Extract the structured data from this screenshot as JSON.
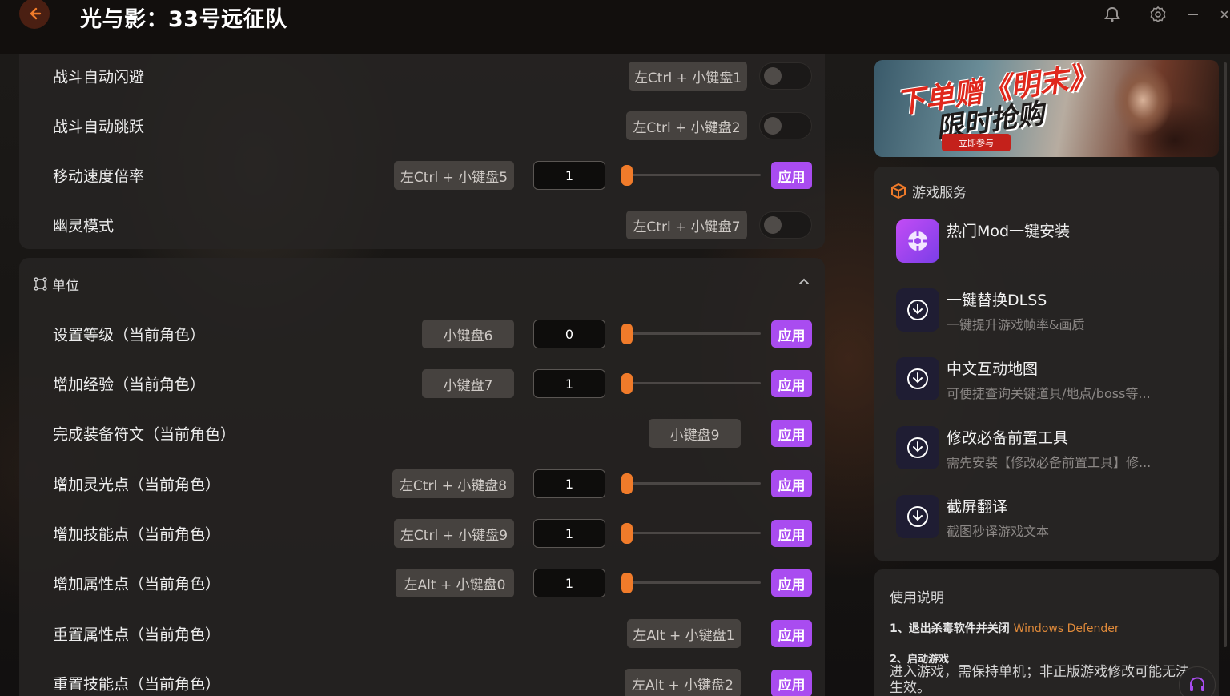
{
  "app": {
    "title": "光与影：33号远征队"
  },
  "colors": {
    "accent": "#f07b2a",
    "apply": "#a94cf0",
    "highlight": "#e08a3a"
  },
  "top_rows": [
    {
      "label": "战斗自动闪避",
      "hotkey": "左Ctrl + 小键盘1",
      "control": "toggle",
      "enabled": false
    },
    {
      "label": "战斗自动跳跃",
      "hotkey": "左Ctrl + 小键盘2",
      "control": "toggle",
      "enabled": false
    },
    {
      "label": "移动速度倍率",
      "hotkey": "左Ctrl + 小键盘5",
      "control": "slider",
      "value": "1",
      "slider_fraction": 0,
      "apply": "应用"
    },
    {
      "label": "幽灵模式",
      "hotkey": "左Ctrl + 小键盘7",
      "control": "toggle",
      "enabled": false
    }
  ],
  "unit_section": {
    "title": "单位",
    "rows": [
      {
        "label": "设置等级（当前角色）",
        "hotkey": "小键盘6",
        "value": "0",
        "slider_fraction": 0,
        "apply": "应用"
      },
      {
        "label": "增加经验（当前角色）",
        "hotkey": "小键盘7",
        "value": "1",
        "slider_fraction": 0,
        "apply": "应用"
      },
      {
        "label": "完成装备符文（当前角色）",
        "hotkey": "小键盘9",
        "apply": "应用"
      },
      {
        "label": "增加灵光点（当前角色）",
        "hotkey": "左Ctrl + 小键盘8",
        "value": "1",
        "slider_fraction": 0,
        "apply": "应用"
      },
      {
        "label": "增加技能点（当前角色）",
        "hotkey": "左Ctrl + 小键盘9",
        "value": "1",
        "slider_fraction": 0,
        "apply": "应用"
      },
      {
        "label": "增加属性点（当前角色）",
        "hotkey": "左Alt + 小键盘0",
        "value": "1",
        "slider_fraction": 0,
        "apply": "应用"
      },
      {
        "label": "重置属性点（当前角色）",
        "hotkey": "左Alt + 小键盘1",
        "apply": "应用"
      },
      {
        "label": "重置技能点（当前角色）",
        "hotkey": "左Alt + 小键盘2",
        "apply": "应用"
      }
    ]
  },
  "banner": {
    "line1": "下单赠《明末》",
    "line2": "限时抢购",
    "cta": "立即参与"
  },
  "services": {
    "title": "游戏服务",
    "items": [
      {
        "title": "热门Mod一键安装",
        "desc": "",
        "icon": "mod-icon"
      },
      {
        "title": "一键替换DLSS",
        "desc": "一键提升游戏帧率&画质",
        "icon": "download-icon"
      },
      {
        "title": "中文互动地图",
        "desc": "可便捷查询关键道具/地点/boss等...",
        "icon": "download-icon"
      },
      {
        "title": "修改必备前置工具",
        "desc": "需先安装【修改必备前置工具】修...",
        "icon": "download-icon"
      },
      {
        "title": "截屏翻译",
        "desc": "截图秒译游戏文本",
        "icon": "download-icon"
      }
    ]
  },
  "usage": {
    "title": "使用说明",
    "step1": "1、退出杀毒软件并关闭",
    "step1_highlight": "Windows Defender",
    "step2": "2、启动游戏",
    "step2_desc": "进入游戏，需保持单机；非正版游戏修改可能无法生效。"
  }
}
